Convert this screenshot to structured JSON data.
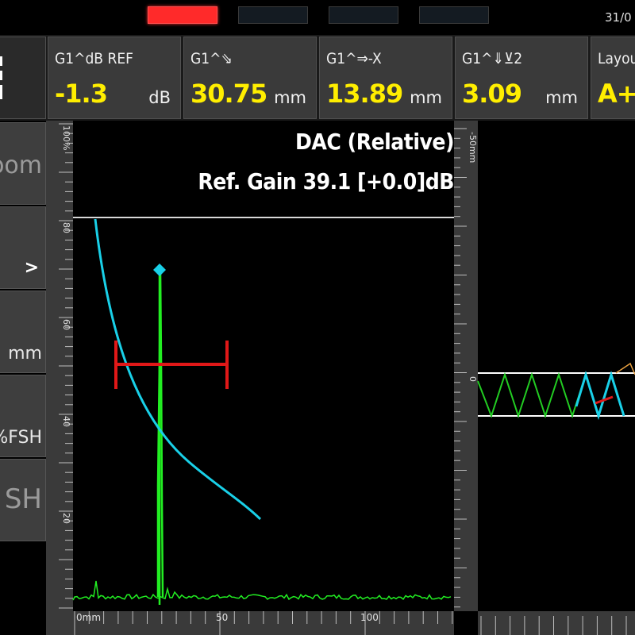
{
  "status": {
    "date": "31/0"
  },
  "readings": [
    {
      "label": "G1^dB REF",
      "value": "-1.3",
      "unit": "dB"
    },
    {
      "label": "G1^⇘",
      "value": "30.75",
      "unit": "mm"
    },
    {
      "label": "G1^⇒-X",
      "value": "13.89",
      "unit": "mm"
    },
    {
      "label": "G1^⇓⊻2",
      "value": "3.09",
      "unit": "mm"
    },
    {
      "label": "Layou",
      "value": "A+P",
      "unit": ""
    }
  ],
  "sidemenu": {
    "zoom_label": "oom",
    "mm_label": "mm",
    "fsh_label": "%FSH",
    "sh_label": "SH",
    "chevron": ">"
  },
  "ascan": {
    "title": "DAC (Relative)",
    "ref_gain": "Ref. Gain 39.1 [+0.0]dB",
    "y_ticks": [
      "100%",
      "80",
      "60",
      "40",
      "20"
    ],
    "x_ticks": [
      "0mm",
      "50",
      "100"
    ]
  },
  "rscan": {
    "y_ticks": [
      "-50mm",
      "0"
    ]
  },
  "colors": {
    "dac_curve": "#19d0e8",
    "signal": "#22ee22",
    "gate": "#e01818",
    "value": "#ffee00"
  }
}
